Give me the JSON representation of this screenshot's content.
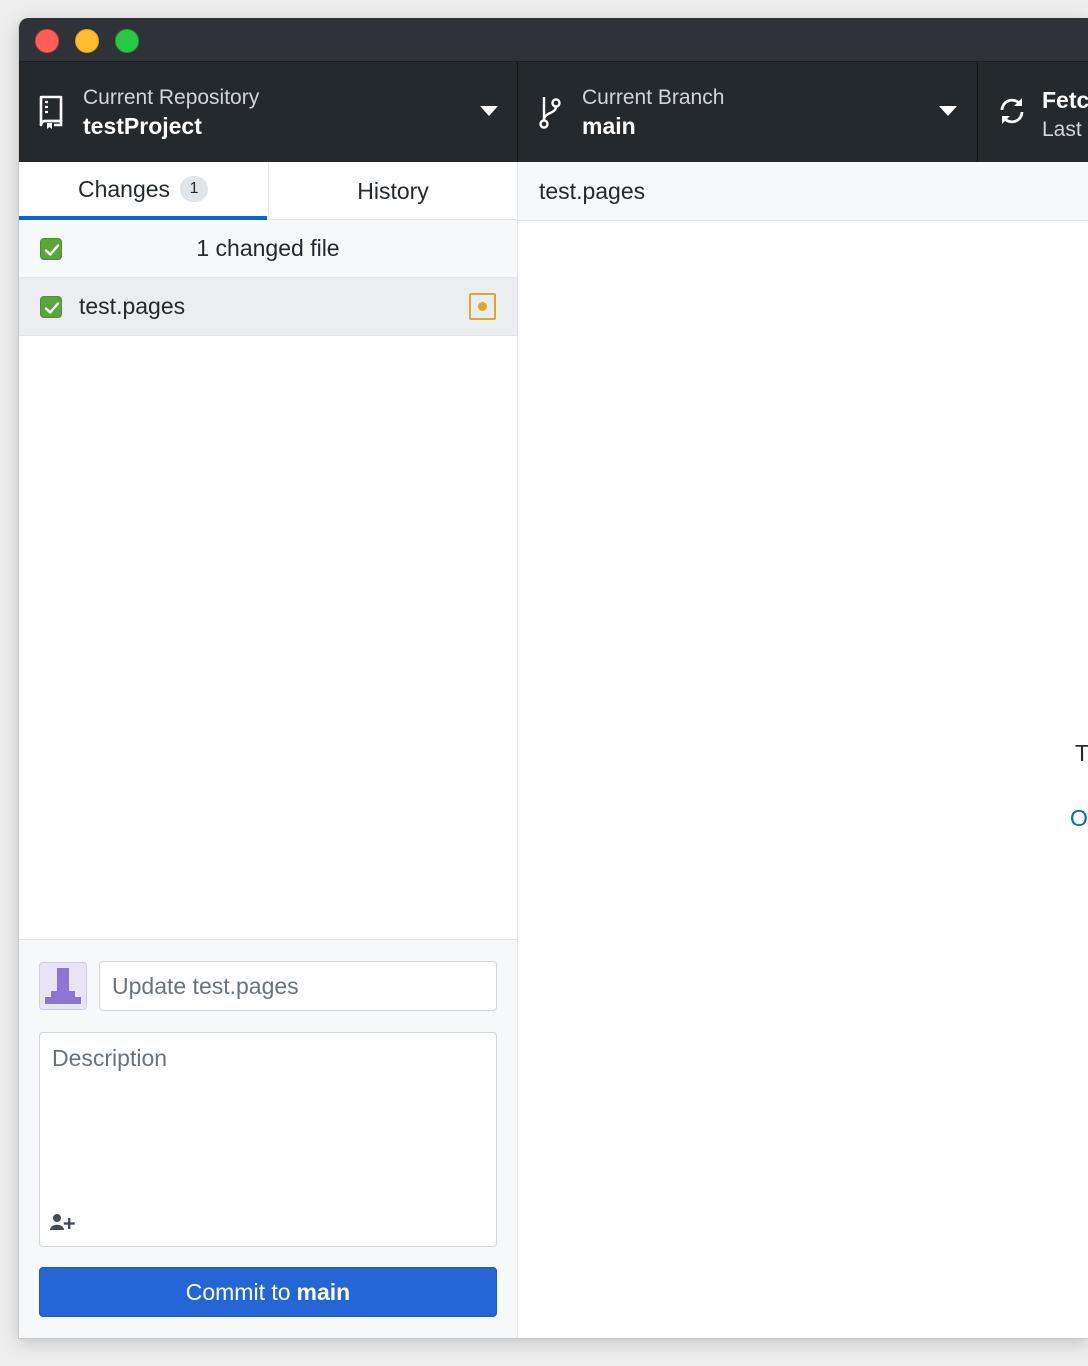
{
  "toolbar": {
    "repository": {
      "label": "Current Repository",
      "value": "testProject"
    },
    "branch": {
      "label": "Current Branch",
      "value": "main"
    },
    "fetch": {
      "value": "Fetc",
      "label": "Last"
    }
  },
  "sidebar": {
    "tabs": [
      {
        "label": "Changes",
        "badge": "1"
      },
      {
        "label": "History"
      }
    ],
    "changed_header": "1 changed file",
    "files": [
      {
        "name": "test.pages",
        "status": "modified"
      }
    ]
  },
  "commit": {
    "summary_placeholder": "Update test.pages",
    "description_placeholder": "Description",
    "button_prefix": "Commit to",
    "button_branch": "main"
  },
  "main": {
    "header_title": "test.pages",
    "binary_text_fragment": "T",
    "link_fragment": "O"
  },
  "colors": {
    "toolbar_bg": "#24292e",
    "accent_blue": "#2466d6",
    "checkbox_green": "#5aa63c",
    "modified_yellow": "#dba72c"
  },
  "icons": {
    "repository": "repo-book-icon",
    "branch": "git-branch-icon",
    "fetch": "sync-icon",
    "coauthor": "person-add-icon"
  }
}
